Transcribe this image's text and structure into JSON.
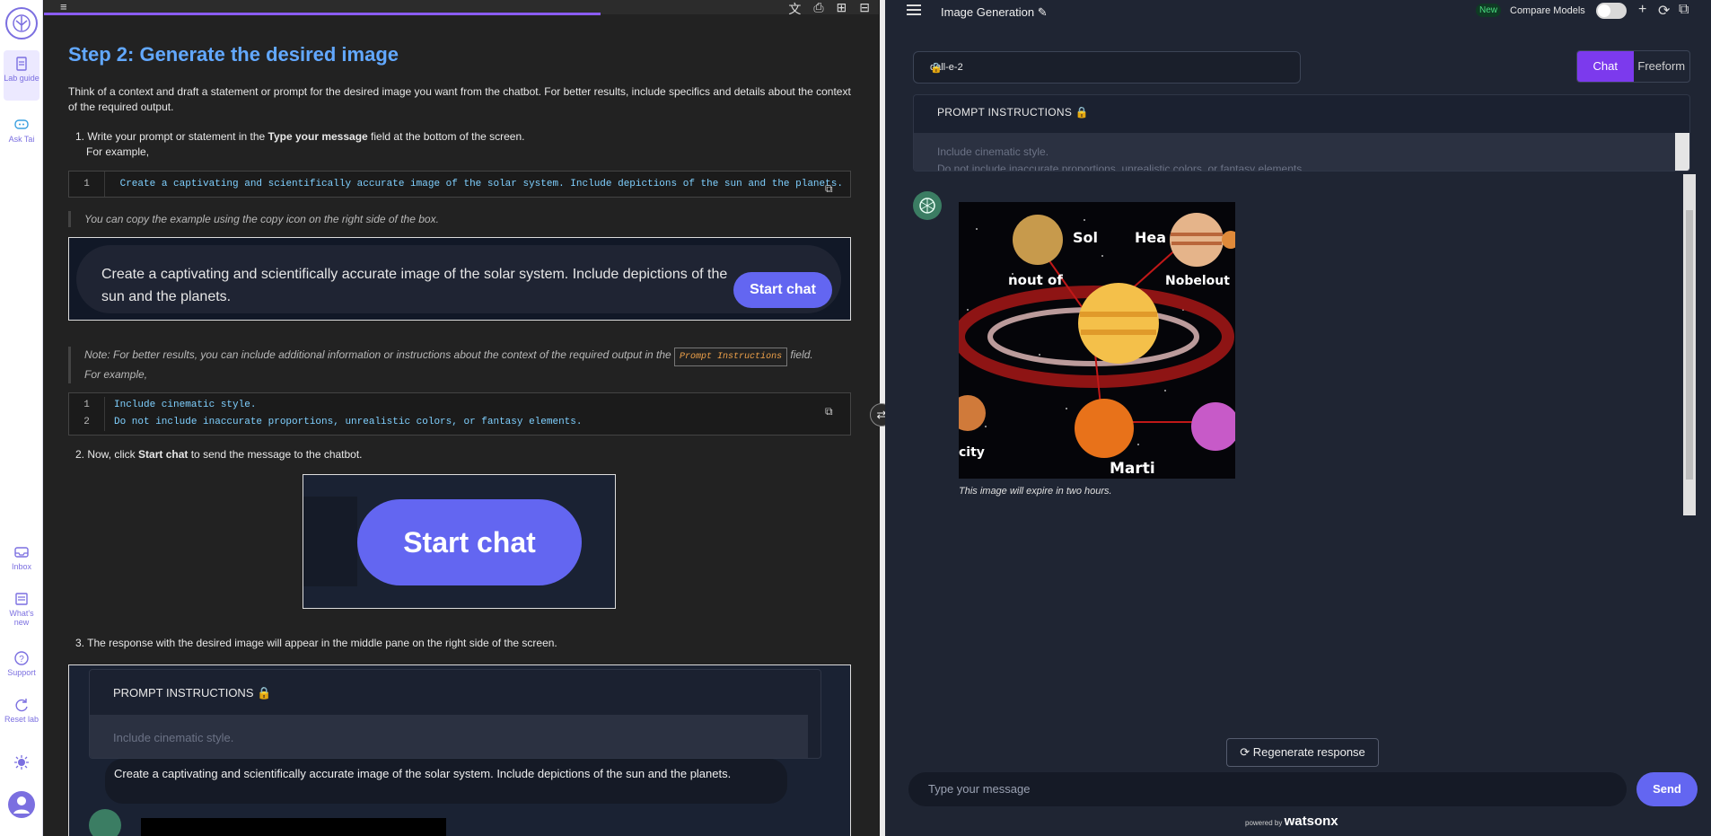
{
  "rail": {
    "lab_guide": "Lab guide",
    "ask_tai": "Ask Tai",
    "inbox": "Inbox",
    "whats_new": "What's new",
    "support": "Support",
    "reset_lab": "Reset lab"
  },
  "guide": {
    "heading": "Step 2: Generate the desired image",
    "intro": "Think of a context and draft a statement or prompt for the desired image you want from the chatbot. For better results, include specifics and details about the context of the required output.",
    "step1_pre": "1. Write your prompt or statement in the ",
    "step1_bold": "Type your message",
    "step1_post": " field at the bottom of the screen.",
    "for_example": "For example,",
    "code1_line": "1",
    "code1_text": "Create a captivating and scientifically accurate image of the solar system. Include depictions of the sun and the planets.",
    "copy_note": "You can copy the example using the copy icon on the right side of the box.",
    "prompt_preview": "Create a captivating and scientifically accurate image of the solar system. Include depictions of the sun and the planets.",
    "start_chat": "Start chat",
    "note_pre": "Note: For better results, you can include additional information or instructions about the context of the required output in the ",
    "note_tag": "Prompt Instructions",
    "note_post": " field.",
    "note_example": "For example,",
    "code2_l1": "Include cinematic style.",
    "code2_l2": "Do not include inaccurate proportions, unrealistic colors, or fantasy elements.",
    "code2_n1": "1",
    "code2_n2": "2",
    "step2_pre": "2. Now, click ",
    "step2_bold": "Start chat",
    "step2_post": " to send the message to the chatbot.",
    "step3": "3. The response with the desired image will appear in the middle pane on the right side of the screen.",
    "shot_pi": "PROMPT INSTRUCTIONS",
    "shot_pi_text": "Include cinematic style.",
    "shot_pi_text2": "Do not include inaccurate proportions, unrealistic colors, or fantasy elements.",
    "shot_msg": "Create a captivating and scientifically accurate image of the solar system. Include depictions of the sun and the planets."
  },
  "app": {
    "title": "Image Generation",
    "new_badge": "New",
    "compare_models": "Compare Models",
    "model": "dall-e-2",
    "mode_chat": "Chat",
    "mode_freeform": "Freeform",
    "pi_heading": "PROMPT INSTRUCTIONS",
    "pi_line1": "Include cinematic style.",
    "pi_line2": "Do not include inaccurate proportions, unrealistic colors, or fantasy elements.",
    "caption": "This image will expire in two hours.",
    "regenerate": "Regenerate response",
    "input_placeholder": "Type your message",
    "send": "Send",
    "powered_by": "powered by",
    "brand": "watsonx"
  },
  "image_labels": [
    "Sol",
    "Hea",
    "nout of",
    "Nobelout",
    "Marti",
    "city"
  ],
  "colors": {
    "accent": "#6366f1",
    "heading_blue": "#62a8ff",
    "purple_mode": "#7c3aed",
    "app_bg": "#1f2533"
  }
}
